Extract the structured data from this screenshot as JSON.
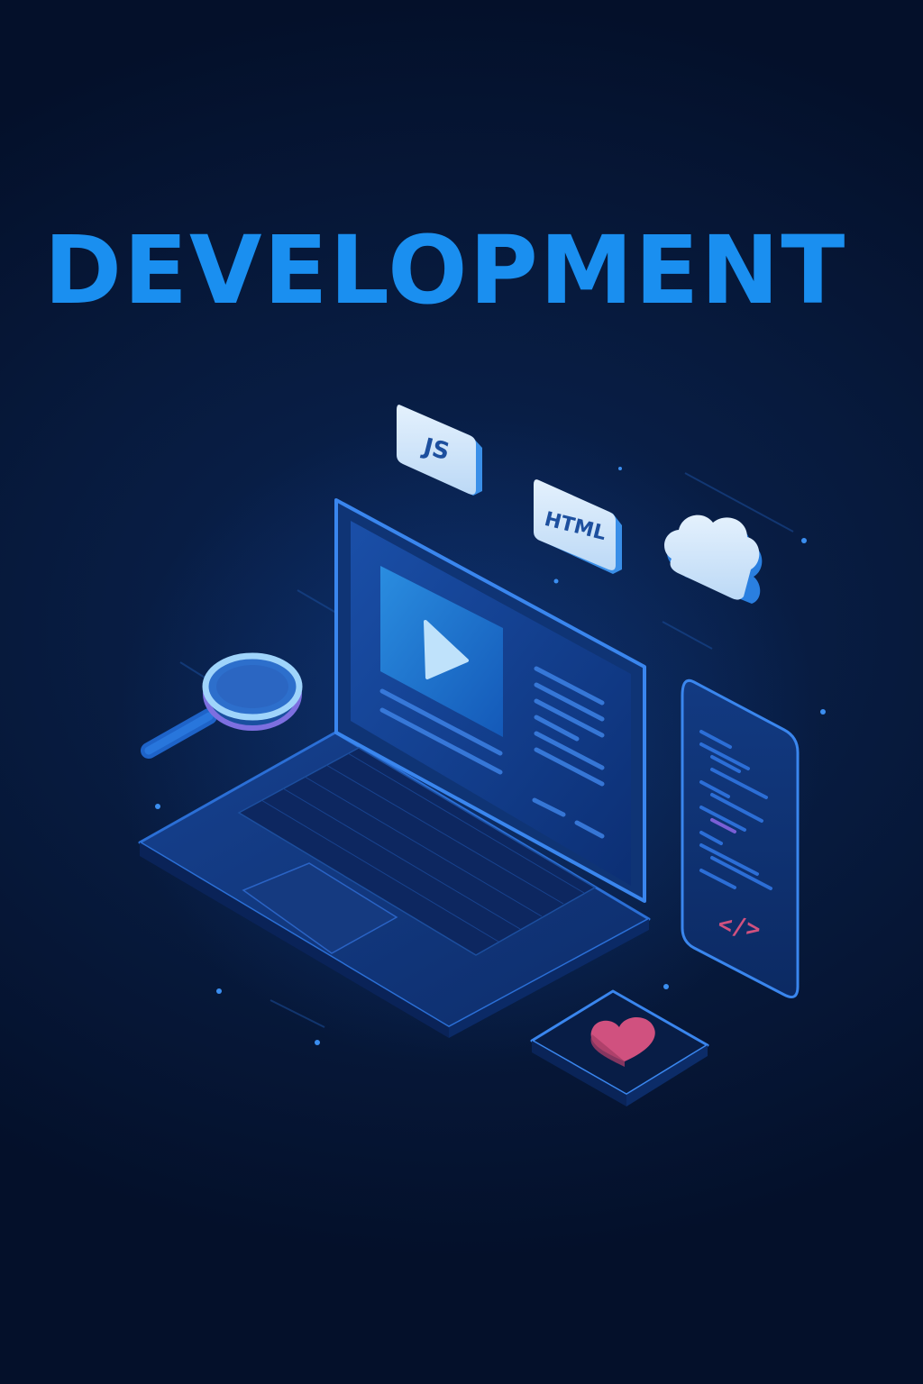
{
  "headline": "DEVELOPMENT",
  "badges": {
    "js": "JS",
    "html": "HTML",
    "code_tag": "</>"
  },
  "colors": {
    "background": "#061633",
    "accent": "#1a8ff0",
    "heart": "#d0517f",
    "card_face": "#cfe6fb"
  },
  "icons": [
    "cloud-icon",
    "play-icon",
    "magnifying-glass-icon",
    "heart-icon",
    "code-icon"
  ]
}
